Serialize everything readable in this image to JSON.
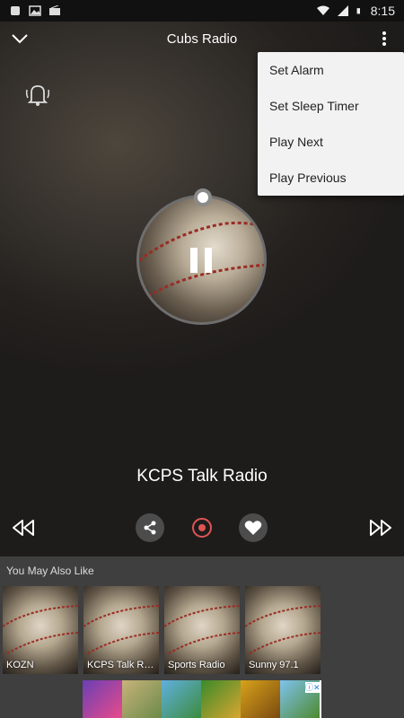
{
  "status_bar": {
    "time": "8:15"
  },
  "header": {
    "title": "Cubs Radio",
    "collapse_icon": "chevron-down-icon",
    "more_icon": "more-vert-icon"
  },
  "alarm": {
    "icon": "ringing-bell-icon"
  },
  "menu": {
    "items": [
      {
        "label": "Set Alarm"
      },
      {
        "label": "Set Sleep Timer"
      },
      {
        "label": "Play Next"
      },
      {
        "label": "Play Previous"
      }
    ]
  },
  "player": {
    "station_name": "KCPS Talk Radio",
    "state_icon": "pause-icon"
  },
  "controls": {
    "previous_icon": "rewind-icon",
    "share_icon": "share-icon",
    "record_icon": "record-icon",
    "favorite_icon": "heart-icon",
    "next_icon": "fast-forward-icon"
  },
  "similar": {
    "heading": "You May Also Like",
    "stations": [
      {
        "name": "KOZN"
      },
      {
        "name": "KCPS Talk Radio"
      },
      {
        "name": "Sports Radio"
      },
      {
        "name": "Sunny 97.1"
      }
    ]
  },
  "colors": {
    "record_accent": "#e05555",
    "menu_bg": "#f2f2f2",
    "section_bg": "#3f3f3f"
  }
}
